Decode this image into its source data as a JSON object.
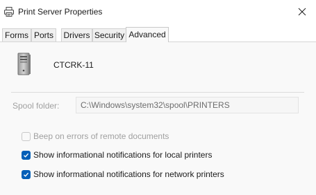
{
  "window": {
    "title": "Print Server Properties"
  },
  "tabs": [
    {
      "label": "Forms",
      "active": false
    },
    {
      "label": "Ports",
      "active": false
    },
    {
      "label": "Drivers",
      "active": false
    },
    {
      "label": "Security",
      "active": false
    },
    {
      "label": "Advanced",
      "active": true
    }
  ],
  "server": {
    "name": "CTCRK-11",
    "icon": "server-tower-icon"
  },
  "spool": {
    "label": "Spool folder:",
    "value": "C:\\Windows\\system32\\spool\\PRINTERS"
  },
  "options": [
    {
      "label": "Beep on errors of remote documents",
      "checked": false,
      "disabled": true
    },
    {
      "label": "Show informational notifications for local printers",
      "checked": true,
      "disabled": false
    },
    {
      "label": "Show informational notifications for network printers",
      "checked": true,
      "disabled": false
    }
  ],
  "colors": {
    "accent": "#005fb8",
    "disabled_text": "#a0a0a0"
  }
}
